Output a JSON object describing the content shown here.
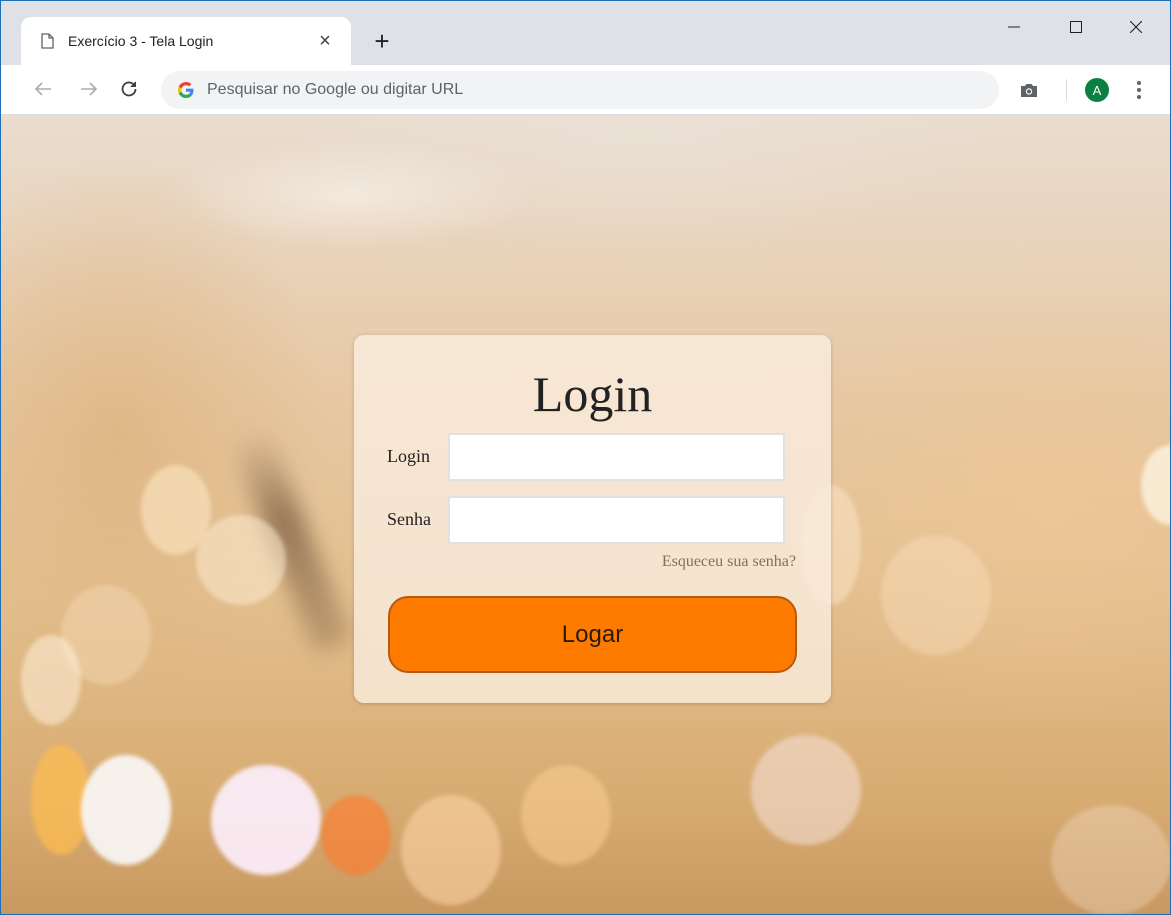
{
  "browser": {
    "tab": {
      "title": "Exercício 3 - Tela Login",
      "close_glyph": "×",
      "icon": "page-icon"
    },
    "new_tab_glyph": "+",
    "omnibox": {
      "placeholder": "Pesquisar no Google ou digitar URL",
      "search_engine_icon": "google-g-icon"
    },
    "profile": {
      "initial": "A",
      "color": "#0b8043"
    }
  },
  "login_card": {
    "title": "Login",
    "login_label": "Login",
    "login_value": "",
    "password_label": "Senha",
    "password_value": "",
    "forgot_link": "Esqueceu sua senha?",
    "submit_label": "Logar",
    "submit_color": "#ff7b00"
  }
}
